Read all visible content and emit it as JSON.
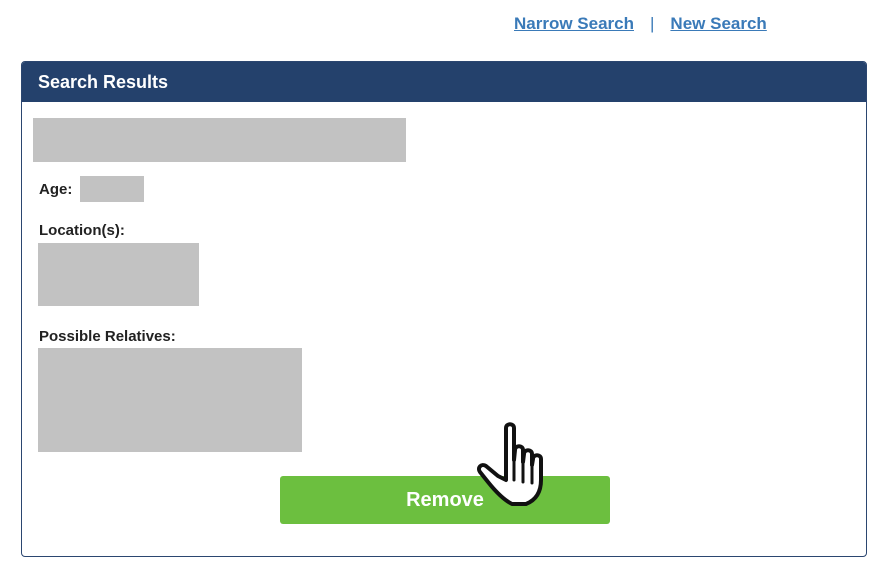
{
  "nav": {
    "narrow_search": "Narrow Search",
    "separator": "|",
    "new_search": "New Search"
  },
  "panel": {
    "title": "Search Results"
  },
  "result": {
    "age_label": "Age:",
    "locations_label": "Location(s):",
    "relatives_label": "Possible Relatives:"
  },
  "actions": {
    "remove_label": "Remove"
  },
  "icons": {
    "cursor": "hand-pointer-icon"
  },
  "colors": {
    "header_bg": "#24416c",
    "link": "#3a7ab8",
    "button_bg": "#6cbf3f",
    "redaction": "#c2c2c2"
  }
}
